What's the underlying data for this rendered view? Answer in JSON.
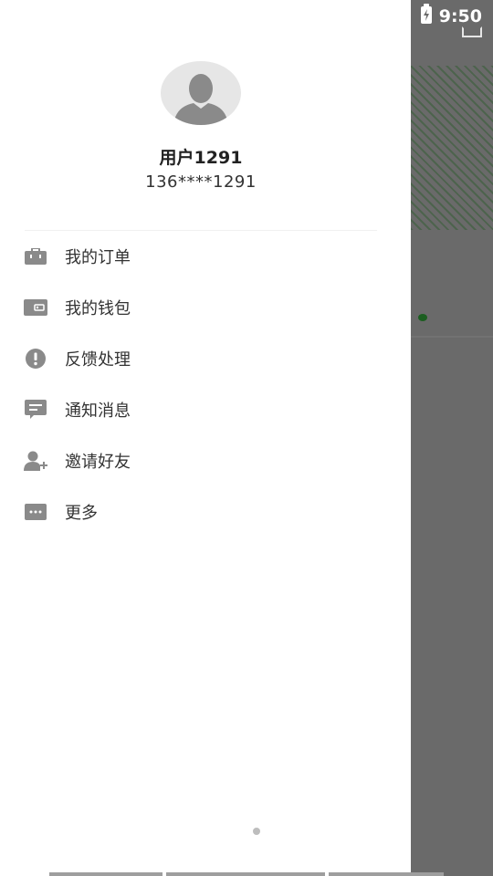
{
  "status_bar": {
    "time": "9:50"
  },
  "user": {
    "name": "用户1291",
    "phone": "136****1291"
  },
  "menu": [
    {
      "label": "我的订单",
      "icon": "briefcase-icon"
    },
    {
      "label": "我的钱包",
      "icon": "wallet-icon"
    },
    {
      "label": "反馈处理",
      "icon": "alert-circle-icon"
    },
    {
      "label": "通知消息",
      "icon": "message-icon"
    },
    {
      "label": "邀请好友",
      "icon": "add-user-icon"
    },
    {
      "label": "更多",
      "icon": "more-icon"
    }
  ],
  "colors": {
    "icon": "#8a8a8a",
    "text": "#333333",
    "overlay": "#6b6b6b"
  }
}
